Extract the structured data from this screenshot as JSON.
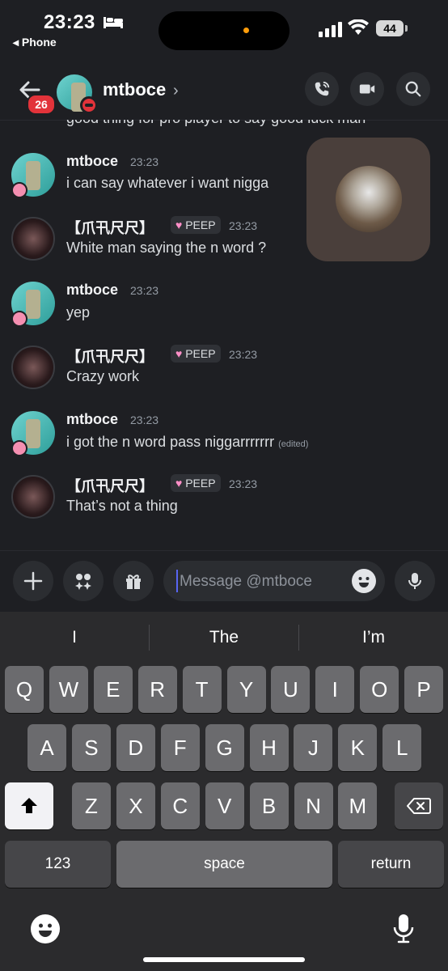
{
  "status": {
    "time": "23:23",
    "back_app": "◂ Phone",
    "battery": "44"
  },
  "header": {
    "badge": "26",
    "name": "mtboce",
    "chevron": "›"
  },
  "cutoff_text": "good thing for pro player to say good luck man",
  "messages": [
    {
      "author": "mtboce",
      "time": "23:23",
      "text": "i can say whatever i want nigga"
    },
    {
      "author": "【爪卂尺尺】",
      "tag": "PEEP",
      "time": "23:23",
      "text": "White man saying the n word ?"
    },
    {
      "author": "mtboce",
      "time": "23:23",
      "text": "yep"
    },
    {
      "author": "【爪卂尺尺】",
      "tag": "PEEP",
      "time": "23:23",
      "text": "Crazy work"
    },
    {
      "author": "mtboce",
      "time": "23:23",
      "text": "i got the n word pass niggarrrrrrr",
      "edited": "(edited)"
    },
    {
      "author": "【爪卂尺尺】",
      "tag": "PEEP",
      "time": "23:23",
      "text": "That’s not a thing"
    }
  ],
  "composer": {
    "placeholder": "Message @mtboce"
  },
  "keyboard": {
    "suggestions": [
      "I",
      "The",
      "I’m"
    ],
    "row1": [
      "Q",
      "W",
      "E",
      "R",
      "T",
      "Y",
      "U",
      "I",
      "O",
      "P"
    ],
    "row2": [
      "A",
      "S",
      "D",
      "F",
      "G",
      "H",
      "J",
      "K",
      "L"
    ],
    "row3": [
      "Z",
      "X",
      "C",
      "V",
      "B",
      "N",
      "M"
    ],
    "numbers": "123",
    "space": "space",
    "return": "return"
  }
}
